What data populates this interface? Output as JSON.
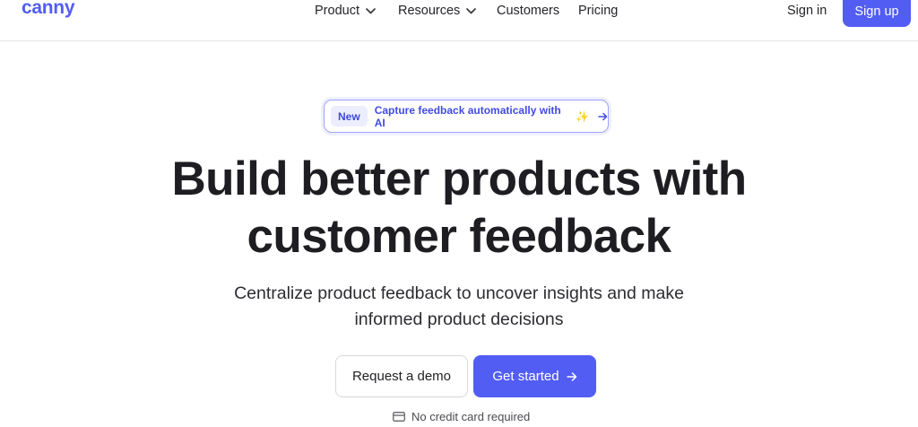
{
  "brand": {
    "logo_text": "canny",
    "accent": "#525df4"
  },
  "nav": {
    "items": [
      {
        "label": "Product",
        "has_dropdown": true,
        "icon": "chevron-down-icon"
      },
      {
        "label": "Resources",
        "has_dropdown": true,
        "icon": "chevron-down-icon"
      },
      {
        "label": "Customers",
        "has_dropdown": false
      },
      {
        "label": "Pricing",
        "has_dropdown": false
      }
    ],
    "sign_in": "Sign in",
    "sign_up": "Sign up"
  },
  "announcement": {
    "badge": "New",
    "text": "Capture feedback automatically with AI",
    "sparkle": "✨",
    "icon": "arrow-right-icon"
  },
  "hero": {
    "headline_line1": "Build better products with",
    "headline_line2": "customer feedback",
    "subhead_line1": "Centralize product feedback to uncover insights and make",
    "subhead_line2": "informed product decisions"
  },
  "cta": {
    "demo_label": "Request a demo",
    "start_label": "Get started",
    "start_icon": "arrow-right-icon"
  },
  "note": {
    "text": "No credit card required",
    "icon": "credit-card-icon"
  }
}
